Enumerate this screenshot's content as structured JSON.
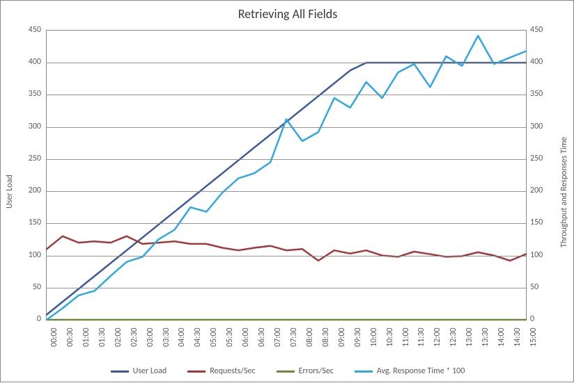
{
  "chart_data": {
    "type": "line",
    "title": "Retrieving All Fields",
    "xlabel": "",
    "ylabel_left": "User Load",
    "ylabel_right": "Throughput and Responses Time",
    "ylim_left": [
      0,
      450
    ],
    "ylim_right": [
      0,
      450
    ],
    "yticks": [
      0,
      50,
      100,
      150,
      200,
      250,
      300,
      350,
      400,
      450
    ],
    "categories": [
      "00:00",
      "00:30",
      "01:00",
      "01:30",
      "02:00",
      "02:30",
      "03:00",
      "03:30",
      "04:00",
      "04:30",
      "05:00",
      "05:30",
      "06:00",
      "06:30",
      "07:00",
      "07:30",
      "08:00",
      "08:30",
      "09:00",
      "09:30",
      "10:00",
      "10:30",
      "11:00",
      "11:30",
      "12:00",
      "12:30",
      "13:00",
      "13:30",
      "14:00",
      "14:30",
      "15:00"
    ],
    "series": [
      {
        "name": "User Load",
        "color": "#3b5998",
        "axis": "left",
        "width": 2.5,
        "values": [
          8,
          28,
          48,
          68,
          88,
          108,
          128,
          148,
          168,
          188,
          208,
          228,
          248,
          268,
          288,
          308,
          328,
          348,
          368,
          388,
          400,
          400,
          400,
          400,
          400,
          400,
          400,
          400,
          400,
          400,
          400
        ]
      },
      {
        "name": "Requests/Sec",
        "color": "#a03a3a",
        "axis": "right",
        "width": 2.5,
        "values": [
          110,
          130,
          120,
          122,
          120,
          130,
          118,
          120,
          122,
          118,
          118,
          112,
          108,
          112,
          115,
          108,
          110,
          92,
          108,
          103,
          108,
          100,
          98,
          106,
          102,
          98,
          99,
          105,
          100,
          92,
          102
        ]
      },
      {
        "name": "Errors/Sec",
        "color": "#6a8a3f",
        "axis": "right",
        "width": 2.5,
        "values": [
          0,
          0,
          0,
          0,
          0,
          0,
          0,
          0,
          0,
          0,
          0,
          0,
          0,
          0,
          0,
          0,
          0,
          0,
          0,
          0,
          0,
          0,
          0,
          0,
          0,
          0,
          0,
          0,
          0,
          0,
          0
        ]
      },
      {
        "name": "Avg. Response Time * 100",
        "color": "#2fa7e2",
        "axis": "right",
        "width": 2.5,
        "values": [
          0,
          18,
          38,
          45,
          68,
          90,
          98,
          125,
          140,
          175,
          168,
          198,
          220,
          228,
          245,
          312,
          278,
          292,
          345,
          330,
          370,
          345,
          385,
          398,
          362,
          410,
          395,
          442,
          398,
          408,
          418
        ]
      }
    ],
    "legend_position": "bottom",
    "grid": "horizontal"
  }
}
